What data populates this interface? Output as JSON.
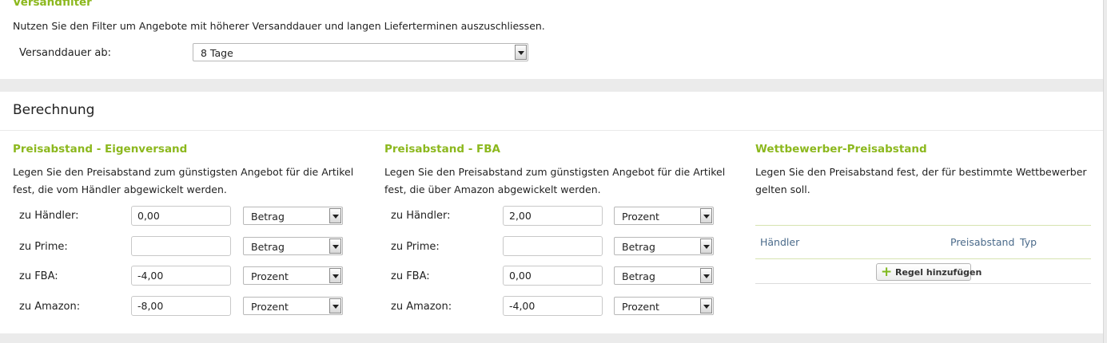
{
  "versandfilter": {
    "title": "Versandfilter",
    "description": "Nutzen Sie den Filter um Angebote mit höherer Versanddauer und langen Lieferterminen auszuschliessen.",
    "label": "Versanddauer ab:",
    "selected": "8 Tage"
  },
  "berechnung": {
    "title": "Berechnung",
    "eigenversand": {
      "title": "Preisabstand - Eigenversand",
      "desc_line1": "Legen Sie den Preisabstand zum günstigsten Angebot für die Artikel",
      "desc_line2": "fest, die vom Händler abgewickelt werden.",
      "rows": [
        {
          "label": "zu Händler:",
          "value": "0,00",
          "type": "Betrag"
        },
        {
          "label": "zu Prime:",
          "value": "",
          "type": "Betrag"
        },
        {
          "label": "zu FBA:",
          "value": "-4,00",
          "type": "Prozent"
        },
        {
          "label": "zu Amazon:",
          "value": "-8,00",
          "type": "Prozent"
        }
      ]
    },
    "fba": {
      "title": "Preisabstand - FBA",
      "desc_line1": "Legen Sie den Preisabstand zum günstigsten Angebot für die Artikel",
      "desc_line2": "fest, die über Amazon abgewickelt werden.",
      "rows": [
        {
          "label": "zu Händler:",
          "value": "2,00",
          "type": "Prozent"
        },
        {
          "label": "zu Prime:",
          "value": "",
          "type": "Betrag"
        },
        {
          "label": "zu FBA:",
          "value": "0,00",
          "type": "Betrag"
        },
        {
          "label": "zu Amazon:",
          "value": "-4,00",
          "type": "Prozent"
        }
      ]
    },
    "wettbewerber": {
      "title": "Wettbewerber-Preisabstand",
      "desc_line1": "Legen Sie den Preisabstand fest, der für bestimmte Wettbewerber",
      "desc_line2": "gelten soll.",
      "columns": [
        "Händler",
        "Preisabstand",
        "Typ"
      ],
      "add_button": "Regel hinzufügen"
    }
  },
  "colors": {
    "accent": "#8cb81e",
    "header_text": "#4a6a8a",
    "background": "#ebebeb"
  }
}
